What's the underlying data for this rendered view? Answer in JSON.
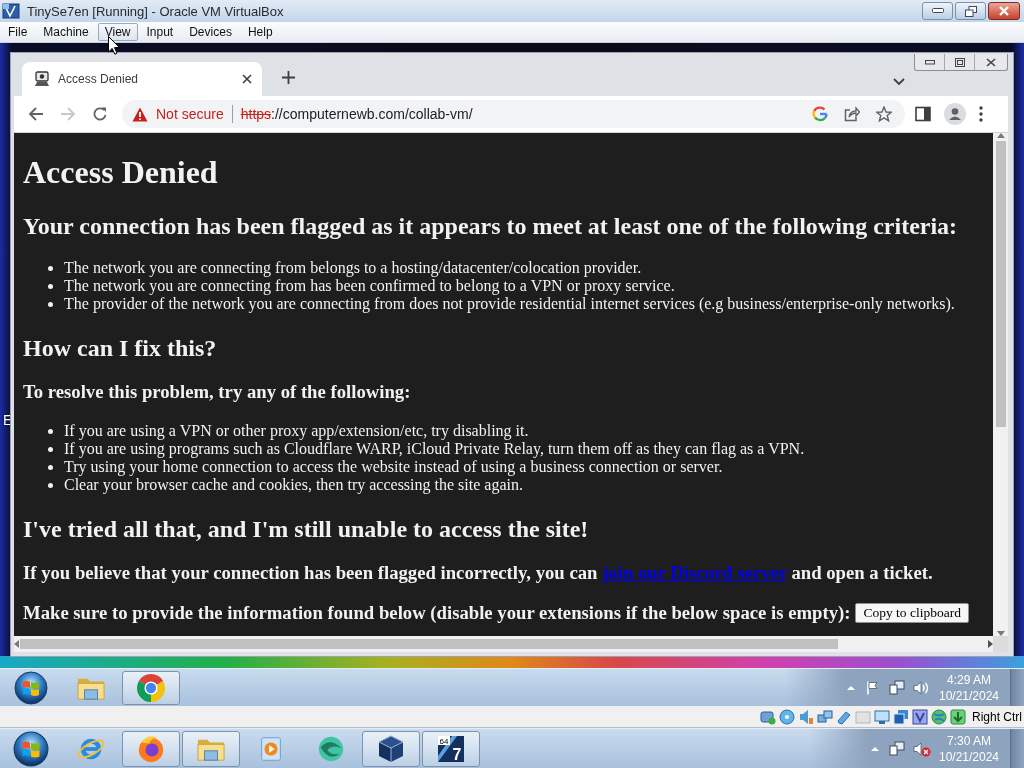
{
  "host_window": {
    "title": "TinySe7en [Running] - Oracle VM VirtualBox"
  },
  "menu_bar": {
    "items": [
      {
        "label": "File",
        "selected": false
      },
      {
        "label": "Machine",
        "selected": false
      },
      {
        "label": "View",
        "selected": true
      },
      {
        "label": "Input",
        "selected": false
      },
      {
        "label": "Devices",
        "selected": false
      },
      {
        "label": "Help",
        "selected": false
      }
    ]
  },
  "desktop": {
    "icon_labels": [
      "E"
    ]
  },
  "browser": {
    "tabs": [
      {
        "title": "Access Denied",
        "selected": true
      }
    ],
    "toolbar": {
      "forward_disabled": true
    },
    "address_bar": {
      "secure": false,
      "security_label": "Not secure",
      "scheme": "https",
      "rest": "://computernewb.com/collab-vm/"
    },
    "page": {
      "blocks": [
        {
          "kind": "title",
          "text": "Access Denied"
        },
        {
          "kind": "heading",
          "text": "Your connection has been flagged as it appears to meet at least one of the following criteria:"
        },
        {
          "kind": "list",
          "items": [
            "The network you are connecting from belongs to a hosting/datacenter/colocation provider.",
            "The network you are connecting from has been confirmed to belong to a VPN or proxy service.",
            "The provider of the network you are connecting from does not provide residential internet services (e.g business/enterprise-only networks)."
          ]
        },
        {
          "kind": "heading",
          "text": "How can I fix this?"
        },
        {
          "kind": "subheading",
          "text": "To resolve this problem, try any of the following:"
        },
        {
          "kind": "list",
          "items": [
            "If you are using a VPN or other proxy app/extension/etc, try disabling it.",
            "If you are using programs such as Cloudflare WARP, iCloud Private Relay, turn them off as they can flag as a VPN.",
            "Try using your home connection to access the website instead of using a business connection or server.",
            "Clear your browser cache and cookies, then try accessing the site again."
          ]
        },
        {
          "kind": "heading",
          "text": "I've tried all that, and I'm still unable to access the site!"
        },
        {
          "kind": "link_paragraph",
          "before": "If you believe that your connection has been flagged incorrectly, you can ",
          "link": "join our Discord server",
          "after": " and open a ticket."
        },
        {
          "kind": "button_paragraph",
          "text": "Make sure to provide the information found below (disable your extensions if the below space is empty):",
          "button": "Copy to clipboard"
        }
      ]
    }
  },
  "guest_taskbar": {
    "apps": [
      {
        "kind": "explorer",
        "running": false
      },
      {
        "kind": "chrome",
        "running": true
      }
    ],
    "tray": {
      "action_center_flag": true,
      "volume_muted": false,
      "time": "4:29 AM",
      "date": "10/21/2024"
    }
  },
  "status_bar": {
    "host_key": "Right Ctrl"
  },
  "host_taskbar": {
    "apps": [
      {
        "kind": "ie",
        "running": false
      },
      {
        "kind": "firefox",
        "running": true
      },
      {
        "kind": "explorer",
        "running": true
      },
      {
        "kind": "media-player",
        "running": false
      },
      {
        "kind": "swirl",
        "running": false
      },
      {
        "kind": "virtualbox",
        "running": true
      },
      {
        "kind": "seven",
        "running": true,
        "badge": "64",
        "mark": "7"
      }
    ],
    "tray": {
      "volume_muted": true,
      "time": "7:30 AM",
      "date": "10/21/2024"
    }
  }
}
